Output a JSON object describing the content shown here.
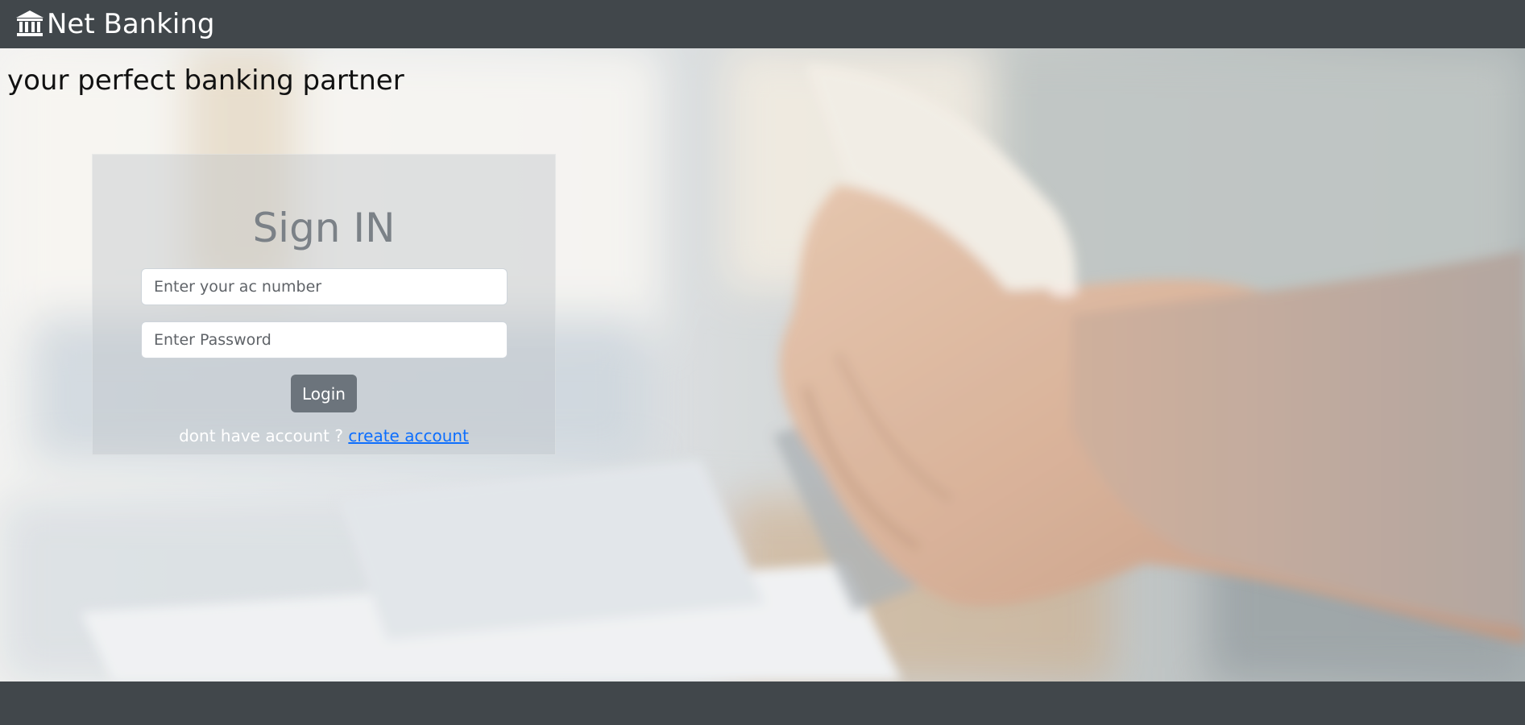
{
  "navbar": {
    "brand_text": "Net Banking",
    "brand_icon": "bank-icon",
    "background_color": "#41474b"
  },
  "hero": {
    "tagline": "your perfect banking partner",
    "background_image": "handshake-photo"
  },
  "login_card": {
    "title": "Sign IN",
    "account_field": {
      "placeholder": "Enter your ac number",
      "value": ""
    },
    "password_field": {
      "placeholder": "Enter Password",
      "value": ""
    },
    "login_button_label": "Login",
    "signup_prompt": "dont have account ?",
    "signup_link_text": "create account",
    "link_color": "#0d6efd",
    "button_color": "#6c747c"
  }
}
